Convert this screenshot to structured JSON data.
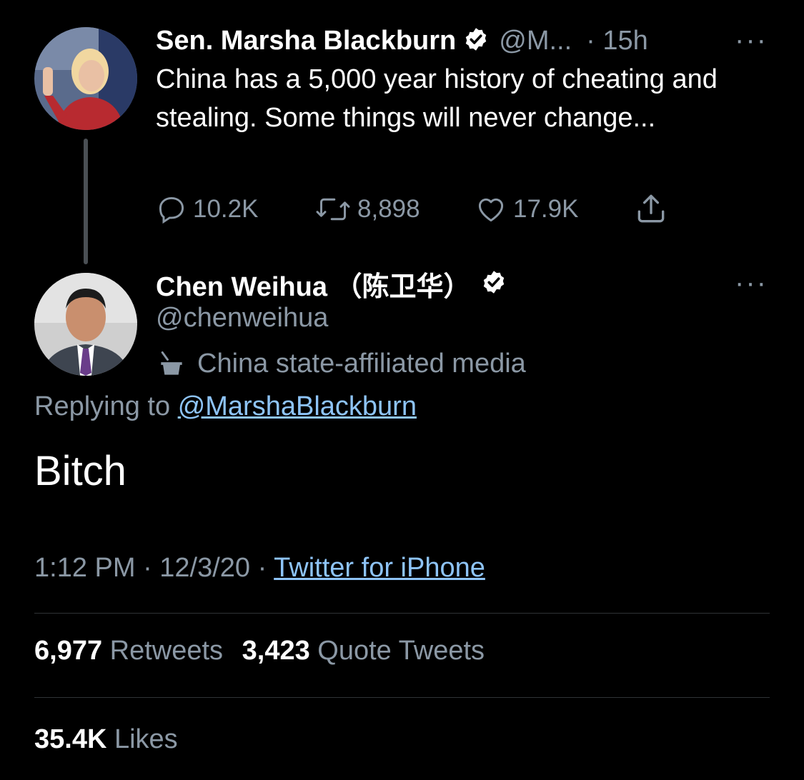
{
  "original_tweet": {
    "author_name": "Sen. Marsha Blackburn",
    "author_handle": "@M...",
    "time": "· 15h",
    "text": "China has a 5,000 year history of cheating and stealing. Some things will never change...",
    "actions": {
      "replies": "10.2K",
      "retweets": "8,898",
      "likes": "17.9K"
    }
  },
  "reply_tweet": {
    "author_name": "Chen Weihua （陈卫华）",
    "author_handle": "@chenweihua",
    "affiliation_label": "China state-affiliated media",
    "replying_to_prefix": "Replying to",
    "replying_to_handle": "@MarshaBlackburn",
    "text": "Bitch",
    "timestamp": "1:12 PM · 12/3/20 ·",
    "source": "Twitter for iPhone"
  },
  "stats": {
    "retweets_count": "6,977",
    "retweets_label": "Retweets",
    "quotes_count": "3,423",
    "quotes_label": "Quote Tweets",
    "likes_count": "35.4K",
    "likes_label": "Likes"
  },
  "more_icon": "···",
  "colors": {
    "background": "#000000",
    "muted_text": "#8b98a5",
    "link": "#8ec4f8",
    "divider": "#2f3336"
  }
}
